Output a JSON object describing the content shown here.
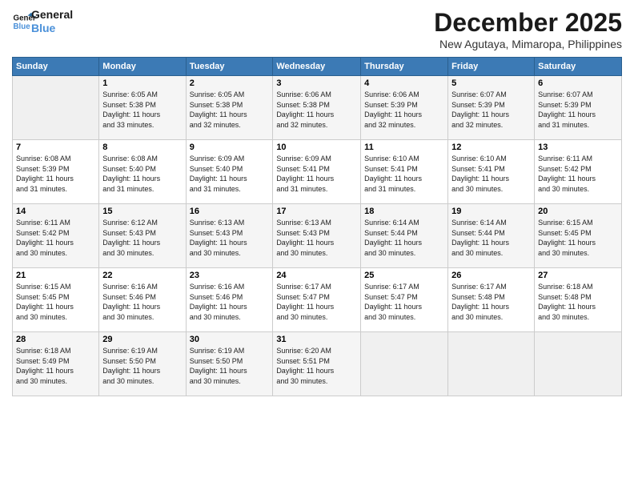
{
  "logo": {
    "line1": "General",
    "line2": "Blue"
  },
  "title": "December 2025",
  "location": "New Agutaya, Mimaropa, Philippines",
  "days_header": [
    "Sunday",
    "Monday",
    "Tuesday",
    "Wednesday",
    "Thursday",
    "Friday",
    "Saturday"
  ],
  "weeks": [
    [
      {
        "num": "",
        "info": ""
      },
      {
        "num": "1",
        "info": "Sunrise: 6:05 AM\nSunset: 5:38 PM\nDaylight: 11 hours\nand 33 minutes."
      },
      {
        "num": "2",
        "info": "Sunrise: 6:05 AM\nSunset: 5:38 PM\nDaylight: 11 hours\nand 32 minutes."
      },
      {
        "num": "3",
        "info": "Sunrise: 6:06 AM\nSunset: 5:38 PM\nDaylight: 11 hours\nand 32 minutes."
      },
      {
        "num": "4",
        "info": "Sunrise: 6:06 AM\nSunset: 5:39 PM\nDaylight: 11 hours\nand 32 minutes."
      },
      {
        "num": "5",
        "info": "Sunrise: 6:07 AM\nSunset: 5:39 PM\nDaylight: 11 hours\nand 32 minutes."
      },
      {
        "num": "6",
        "info": "Sunrise: 6:07 AM\nSunset: 5:39 PM\nDaylight: 11 hours\nand 31 minutes."
      }
    ],
    [
      {
        "num": "7",
        "info": "Sunrise: 6:08 AM\nSunset: 5:39 PM\nDaylight: 11 hours\nand 31 minutes."
      },
      {
        "num": "8",
        "info": "Sunrise: 6:08 AM\nSunset: 5:40 PM\nDaylight: 11 hours\nand 31 minutes."
      },
      {
        "num": "9",
        "info": "Sunrise: 6:09 AM\nSunset: 5:40 PM\nDaylight: 11 hours\nand 31 minutes."
      },
      {
        "num": "10",
        "info": "Sunrise: 6:09 AM\nSunset: 5:41 PM\nDaylight: 11 hours\nand 31 minutes."
      },
      {
        "num": "11",
        "info": "Sunrise: 6:10 AM\nSunset: 5:41 PM\nDaylight: 11 hours\nand 31 minutes."
      },
      {
        "num": "12",
        "info": "Sunrise: 6:10 AM\nSunset: 5:41 PM\nDaylight: 11 hours\nand 30 minutes."
      },
      {
        "num": "13",
        "info": "Sunrise: 6:11 AM\nSunset: 5:42 PM\nDaylight: 11 hours\nand 30 minutes."
      }
    ],
    [
      {
        "num": "14",
        "info": "Sunrise: 6:11 AM\nSunset: 5:42 PM\nDaylight: 11 hours\nand 30 minutes."
      },
      {
        "num": "15",
        "info": "Sunrise: 6:12 AM\nSunset: 5:43 PM\nDaylight: 11 hours\nand 30 minutes."
      },
      {
        "num": "16",
        "info": "Sunrise: 6:13 AM\nSunset: 5:43 PM\nDaylight: 11 hours\nand 30 minutes."
      },
      {
        "num": "17",
        "info": "Sunrise: 6:13 AM\nSunset: 5:43 PM\nDaylight: 11 hours\nand 30 minutes."
      },
      {
        "num": "18",
        "info": "Sunrise: 6:14 AM\nSunset: 5:44 PM\nDaylight: 11 hours\nand 30 minutes."
      },
      {
        "num": "19",
        "info": "Sunrise: 6:14 AM\nSunset: 5:44 PM\nDaylight: 11 hours\nand 30 minutes."
      },
      {
        "num": "20",
        "info": "Sunrise: 6:15 AM\nSunset: 5:45 PM\nDaylight: 11 hours\nand 30 minutes."
      }
    ],
    [
      {
        "num": "21",
        "info": "Sunrise: 6:15 AM\nSunset: 5:45 PM\nDaylight: 11 hours\nand 30 minutes."
      },
      {
        "num": "22",
        "info": "Sunrise: 6:16 AM\nSunset: 5:46 PM\nDaylight: 11 hours\nand 30 minutes."
      },
      {
        "num": "23",
        "info": "Sunrise: 6:16 AM\nSunset: 5:46 PM\nDaylight: 11 hours\nand 30 minutes."
      },
      {
        "num": "24",
        "info": "Sunrise: 6:17 AM\nSunset: 5:47 PM\nDaylight: 11 hours\nand 30 minutes."
      },
      {
        "num": "25",
        "info": "Sunrise: 6:17 AM\nSunset: 5:47 PM\nDaylight: 11 hours\nand 30 minutes."
      },
      {
        "num": "26",
        "info": "Sunrise: 6:17 AM\nSunset: 5:48 PM\nDaylight: 11 hours\nand 30 minutes."
      },
      {
        "num": "27",
        "info": "Sunrise: 6:18 AM\nSunset: 5:48 PM\nDaylight: 11 hours\nand 30 minutes."
      }
    ],
    [
      {
        "num": "28",
        "info": "Sunrise: 6:18 AM\nSunset: 5:49 PM\nDaylight: 11 hours\nand 30 minutes."
      },
      {
        "num": "29",
        "info": "Sunrise: 6:19 AM\nSunset: 5:50 PM\nDaylight: 11 hours\nand 30 minutes."
      },
      {
        "num": "30",
        "info": "Sunrise: 6:19 AM\nSunset: 5:50 PM\nDaylight: 11 hours\nand 30 minutes."
      },
      {
        "num": "31",
        "info": "Sunrise: 6:20 AM\nSunset: 5:51 PM\nDaylight: 11 hours\nand 30 minutes."
      },
      {
        "num": "",
        "info": ""
      },
      {
        "num": "",
        "info": ""
      },
      {
        "num": "",
        "info": ""
      }
    ]
  ]
}
